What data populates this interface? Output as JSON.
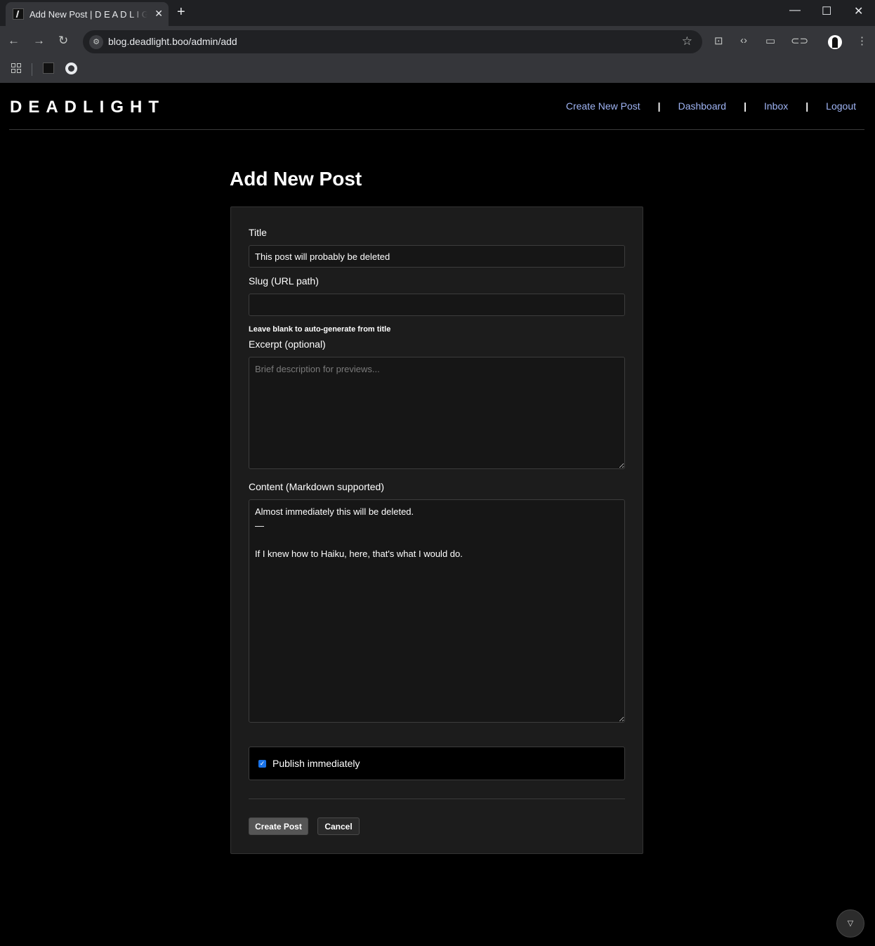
{
  "browser": {
    "tab_title": "Add New Post | D E A D L I G H T",
    "tab_close": "✕",
    "new_tab": "+",
    "url": "blog.deadlight.boo/admin/add",
    "window_controls": {
      "minimize": "—",
      "maximize": "☐",
      "close": "✕"
    },
    "icons": [
      "back-icon",
      "forward-icon",
      "reload-icon",
      "site-info-icon",
      "bookmark-star-icon",
      "search-tab-icon",
      "code-icon",
      "devices-icon",
      "link-icon",
      "profile-icon",
      "more-icon"
    ],
    "bookmarks": [
      "apps-icon",
      "deadlight-favicon",
      "github-icon"
    ]
  },
  "site": {
    "logo": "DEADLIGHT",
    "nav": {
      "create": "Create New Post",
      "dashboard": "Dashboard",
      "inbox": "Inbox",
      "logout": "Logout",
      "separator": "|"
    }
  },
  "form": {
    "heading": "Add New Post",
    "title_label": "Title",
    "title_value": "This post will probably be deleted",
    "slug_label": "Slug (URL path)",
    "slug_value": "",
    "slug_hint": "Leave blank to auto-generate from title",
    "excerpt_label": "Excerpt (optional)",
    "excerpt_placeholder": "Brief description for previews...",
    "content_label": "Content (Markdown supported)",
    "content_value": "Almost immediately this will be deleted.\n—\n\nIf I knew how to Haiku, here, that's what I would do.",
    "publish_label": "Publish immediately",
    "publish_checked": true,
    "submit_label": "Create Post",
    "cancel_label": "Cancel"
  },
  "colors": {
    "nav_link": "#9fb4f4",
    "card_bg": "#1c1c1c",
    "checkbox": "#1a73e8"
  }
}
